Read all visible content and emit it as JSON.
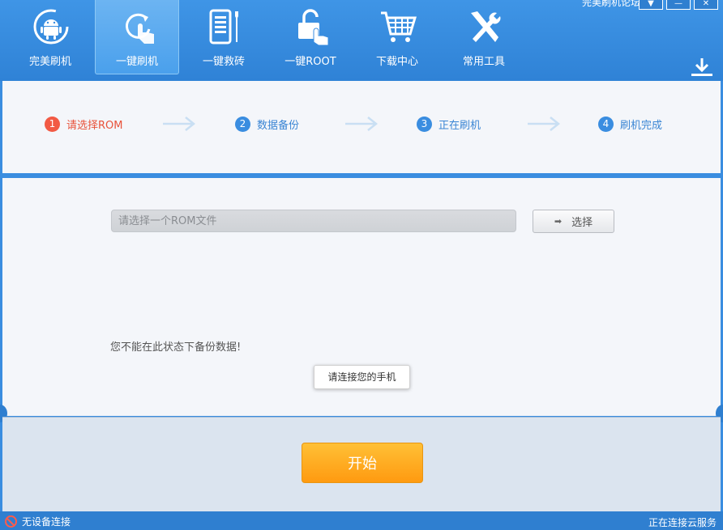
{
  "header": {
    "forum_link": "完美刷机论坛",
    "window_controls": [
      "▼",
      "—",
      "✕"
    ],
    "nav": [
      {
        "label": "完美刷机",
        "icon": "android-icon",
        "active": false
      },
      {
        "label": "一键刷机",
        "icon": "refresh-hand-icon",
        "active": true
      },
      {
        "label": "一键救砖",
        "icon": "phone-tools-icon",
        "active": false
      },
      {
        "label": "一键ROOT",
        "icon": "unlock-icon",
        "active": false
      },
      {
        "label": "下载中心",
        "icon": "cart-icon",
        "active": false
      },
      {
        "label": "常用工具",
        "icon": "tools-icon",
        "active": false
      }
    ],
    "download_icon": "download-icon"
  },
  "steps": [
    {
      "num": "1",
      "label": "请选择ROM",
      "current": true
    },
    {
      "num": "2",
      "label": "数据备份",
      "current": false
    },
    {
      "num": "3",
      "label": "正在刷机",
      "current": false
    },
    {
      "num": "4",
      "label": "刷机完成",
      "current": false
    }
  ],
  "main": {
    "rom_placeholder": "请选择一个ROM文件",
    "select_button": "选择",
    "warning": "您不能在此状态下备份数据!",
    "tooltip": "请连接您的手机",
    "start_button": "开始"
  },
  "status": {
    "left": "无设备连接",
    "right": "正在连接云服务"
  },
  "colors": {
    "brand_blue": "#3a8de0",
    "current_step": "#f25a44",
    "start_orange": "#ff9a10"
  }
}
